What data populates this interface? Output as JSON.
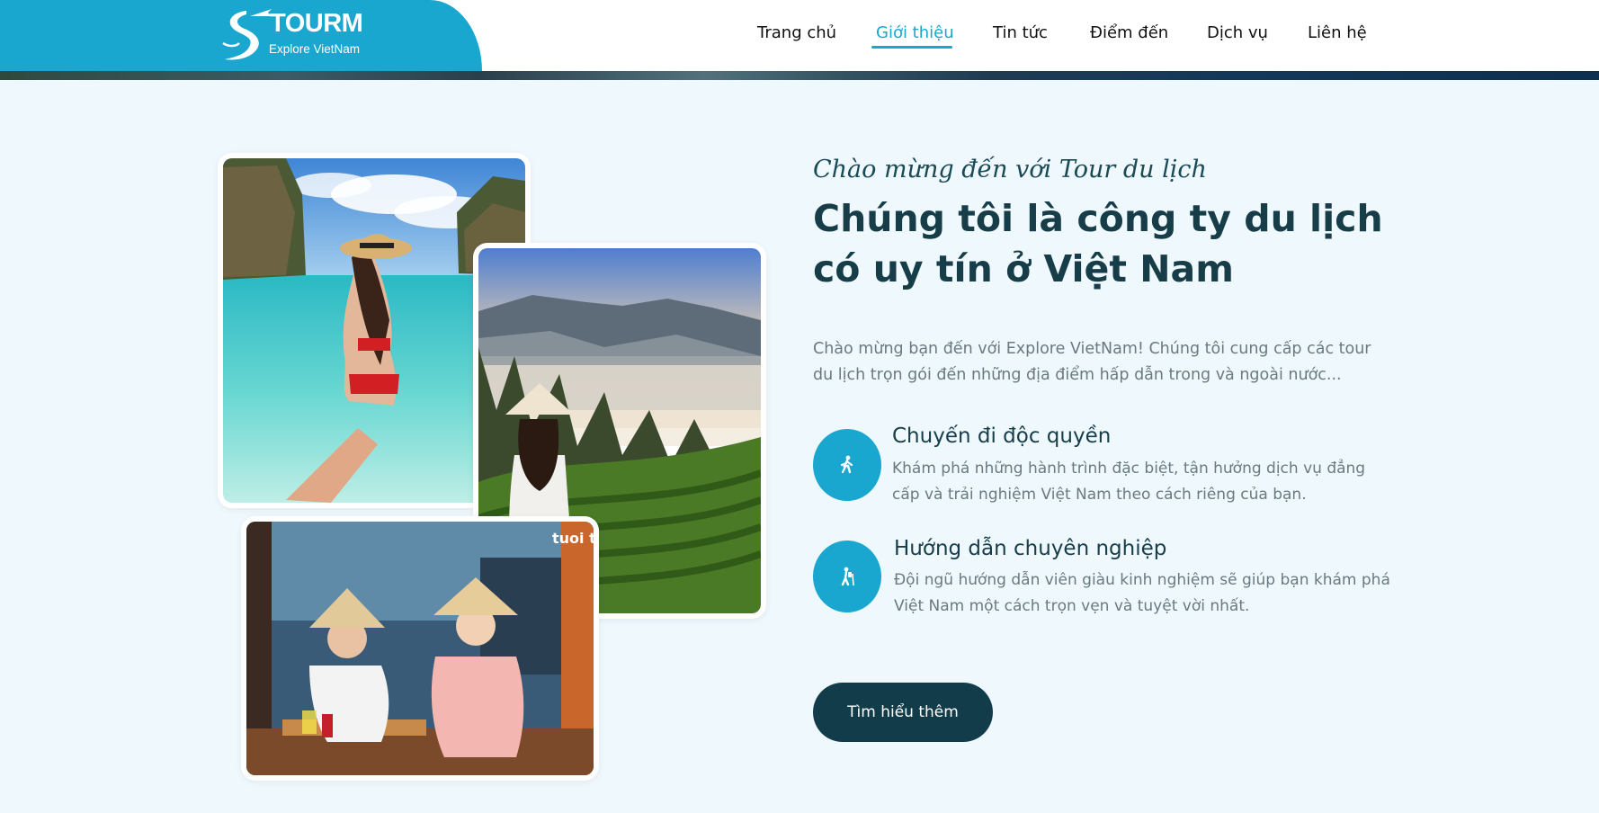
{
  "brand": {
    "name": "TOURM",
    "subtitle": "Explore VietNam",
    "color_primary": "#1aa7cf",
    "color_dark": "#123c4a"
  },
  "nav": {
    "items": [
      "Trang chủ",
      "Giới thiệu",
      "Tin tức",
      "Điểm đến",
      "Dịch vụ",
      "Liên hệ"
    ],
    "active": "Giới thiệu"
  },
  "about": {
    "tagline": "Chào mừng đến với Tour du lịch",
    "headline": "Chúng tôi là công ty du lịch có uy tín ở Việt Nam",
    "intro": "Chào mừng bạn đến với Explore VietNam! Chúng tôi cung cấp các tour du lịch trọn gói đến những địa điểm hấp dẫn trong và ngoài nước...",
    "features": [
      {
        "icon": "walking-person-icon",
        "title": "Chuyến đi độc quyền",
        "desc": "Khám phá những hành trình đặc biệt, tận hưởng dịch vụ đẳng cấp và trải nghiệm Việt Nam theo cách riêng của bạn."
      },
      {
        "icon": "hiker-icon",
        "title": "Hướng dẫn chuyên nghiệp",
        "desc": "Đội ngũ hướng dẫn viên giàu kinh nghiệm sẽ giúp bạn khám phá Việt Nam một cách trọn vẹn và tuyệt vời nhất."
      }
    ],
    "cta_label": "Tìm hiểu thêm"
  },
  "photos": {
    "watermark": "tuoi t"
  }
}
